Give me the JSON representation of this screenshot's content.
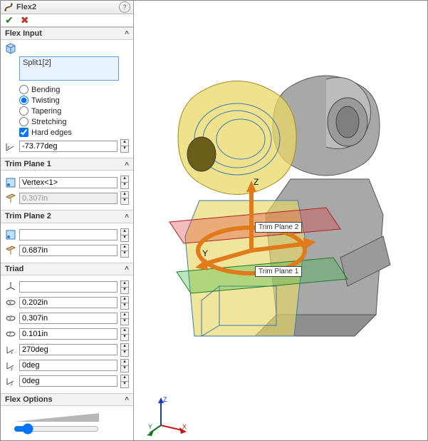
{
  "title": "Flex2",
  "sections": {
    "flexInput": {
      "header": "Flex Input",
      "selection": "Split1[2]",
      "modes": {
        "bending": "Bending",
        "twisting": "Twisting",
        "tapering": "Tapering",
        "stretching": "Stretching"
      },
      "selectedMode": "Twisting",
      "hardEdgesLabel": "Hard edges",
      "hardEdges": true,
      "angleValue": "-73.77deg"
    },
    "trimPlane1": {
      "header": "Trim Plane 1",
      "reference": "Vertex<1>",
      "distance": "0.307in"
    },
    "trimPlane2": {
      "header": "Trim Plane 2",
      "reference": "",
      "distance": "0.687in"
    },
    "triad": {
      "header": "Triad",
      "reference": "",
      "x": "0.202in",
      "y": "0.307in",
      "z": "0.101in",
      "rx": "270deg",
      "ry": "0deg",
      "rz": "0deg"
    },
    "flexOptions": {
      "header": "Flex Options"
    }
  },
  "viewport": {
    "trimPlane1Label": "Trim Plane 1",
    "trimPlane2Label": "Trim Plane 2",
    "axisZ": "Z",
    "axisY": "Y",
    "csysX": "X",
    "csysY": "Y",
    "csysZ": "Z"
  }
}
